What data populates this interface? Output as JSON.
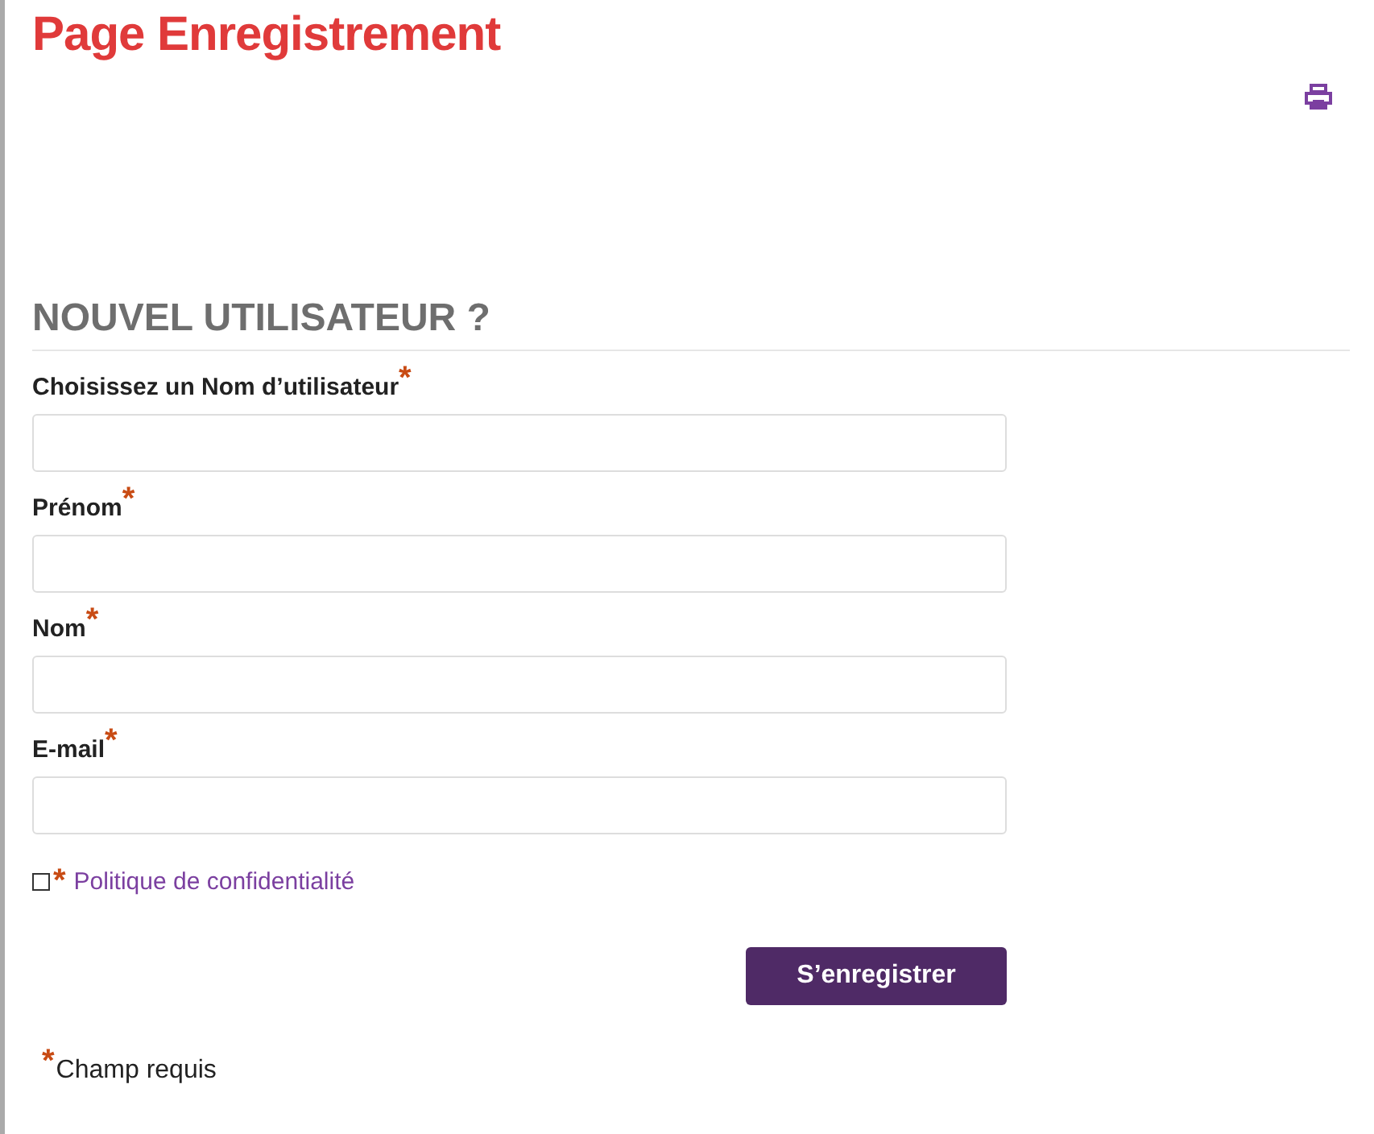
{
  "page_title": "Page Enregistrement",
  "section_heading": "NOUVEL UTILISATEUR ?",
  "fields": [
    {
      "label": "Choisissez un Nom d’utilisateur",
      "required_mark": "*"
    },
    {
      "label": "Prénom",
      "required_mark": "*"
    },
    {
      "label": "Nom",
      "required_mark": "*"
    },
    {
      "label": "E-mail",
      "required_mark": "*"
    }
  ],
  "privacy": {
    "checked": false,
    "required_mark": "*",
    "link": "Politique de confidentialité"
  },
  "submit_button": "S’enregistrer",
  "footnote": {
    "required_mark": "*",
    "text": "Champ requis"
  }
}
